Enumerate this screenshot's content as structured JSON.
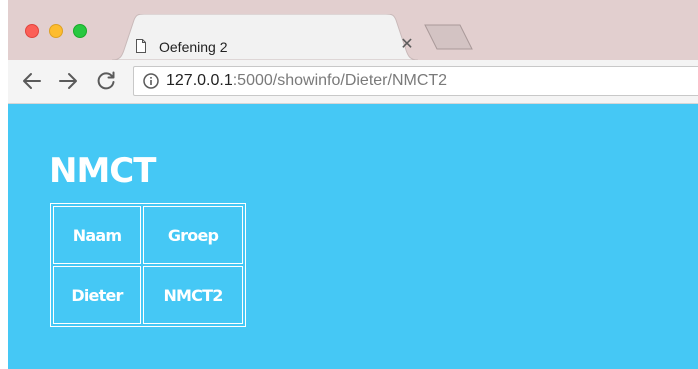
{
  "browser": {
    "tab": {
      "title": "Oefening 2",
      "close_glyph": "✕",
      "icon": "page-icon"
    },
    "new_tab_icon": "new-tab-icon",
    "toolbar": {
      "back_icon": "back-arrow-icon",
      "forward_icon": "forward-arrow-icon",
      "reload_icon": "reload-icon"
    },
    "address_bar": {
      "info_icon": "info-icon",
      "host": "127.0.0.1",
      "rest": ":5000/showinfo/Dieter/NMCT2"
    }
  },
  "page": {
    "background_color": "#45c8f5",
    "heading": "NMCT",
    "table": {
      "headers": [
        "Naam",
        "Groep"
      ],
      "rows": [
        [
          "Dieter",
          "NMCT2"
        ]
      ]
    }
  }
}
